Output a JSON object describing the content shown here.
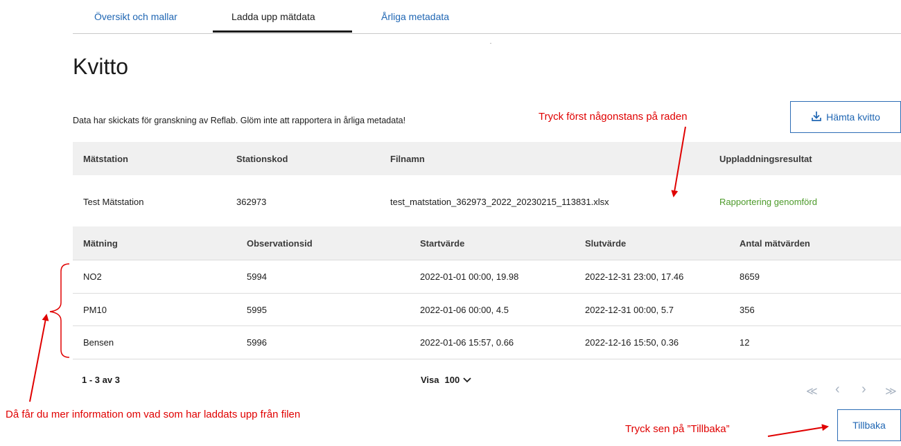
{
  "tabs": [
    {
      "label": "Översikt och mallar"
    },
    {
      "label": "Ladda upp mätdata"
    },
    {
      "label": "Årliga metadata"
    }
  ],
  "page": {
    "title": "Kvitto",
    "info_text": "Data har skickats för granskning av Reflab. Glöm inte att rapportera in årliga metadata!",
    "download_button": "Hämta kvitto",
    "back_button": "Tillbaka"
  },
  "station_table": {
    "headers": [
      "Mätstation",
      "Stationskod",
      "Filnamn",
      "Uppladdningsresultat"
    ],
    "row": {
      "station": "Test Mätstation",
      "code": "362973",
      "filename": "test_matstation_362973_2022_20230215_113831.xlsx",
      "result": "Rapportering genomförd"
    }
  },
  "measurement_table": {
    "headers": [
      "Mätning",
      "Observationsid",
      "Startvärde",
      "Slutvärde",
      "Antal mätvärden"
    ],
    "rows": [
      {
        "name": "NO2",
        "obs": "5994",
        "start": "2022-01-01 00:00, 19.98",
        "end": "2022-12-31 23:00, 17.46",
        "count": "8659"
      },
      {
        "name": "PM10",
        "obs": "5995",
        "start": "2022-01-06 00:00, 4.5",
        "end": "2022-12-31 00:00, 5.7",
        "count": "356"
      },
      {
        "name": "Bensen",
        "obs": "5996",
        "start": "2022-01-06 15:57, 0.66",
        "end": "2022-12-16 15:50, 0.36",
        "count": "12"
      }
    ]
  },
  "pagination": {
    "range": "1 - 3 av 3",
    "show_label": "Visa",
    "show_value": "100",
    "first": "≪",
    "prev": "‹",
    "next": "›",
    "last": "≫"
  },
  "annotations": {
    "top": "Tryck först någonstans på raden",
    "left": "Då får du mer information om vad som har laddats upp från filen",
    "bottom": "Tryck sen på ”Tillbaka”"
  },
  "colors": {
    "link": "#1f66b3",
    "success": "#4c9a2a",
    "annotation": "#e00000"
  }
}
